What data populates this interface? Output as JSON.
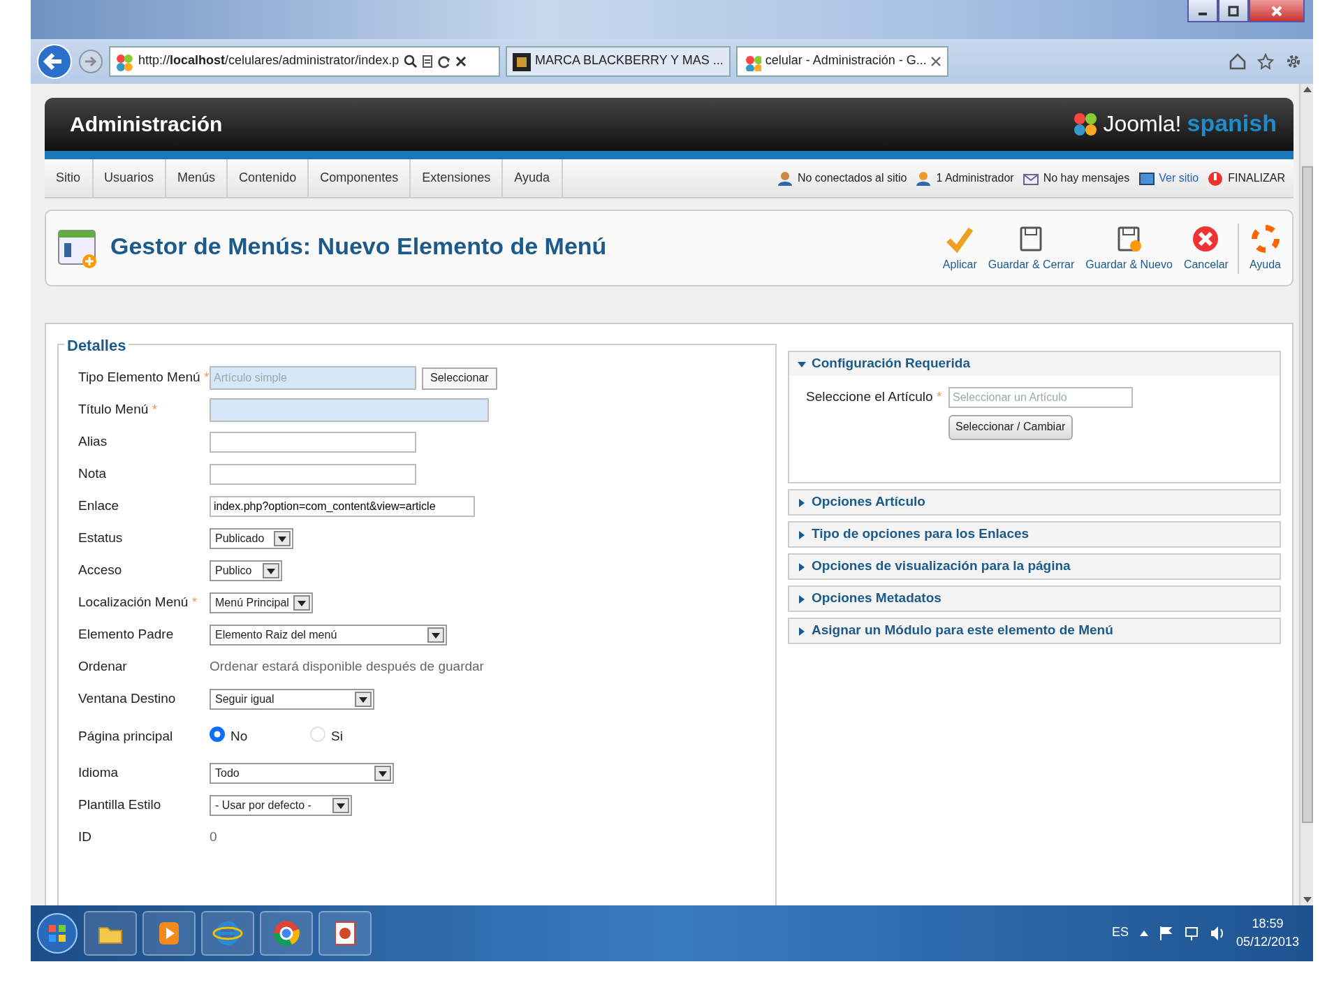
{
  "browser": {
    "address": "http://**localhost**/celulares/administrator/index.p",
    "tabs": [
      {
        "title": "MARCA BLACKBERRY Y MAS ...",
        "selected": false,
        "closable": false
      },
      {
        "title": "celular - Administración - G...",
        "selected": true,
        "closable": true
      }
    ]
  },
  "header": {
    "title": "Administración",
    "logo_text": "Joomla!",
    "logo_tag": "spanish"
  },
  "menu": [
    "Sitio",
    "Usuarios",
    "Menús",
    "Contenido",
    "Componentes",
    "Extensiones",
    "Ayuda"
  ],
  "status": [
    {
      "kind": "users",
      "text": "No conectados al sitio"
    },
    {
      "kind": "admin",
      "text": "1 Administrador"
    },
    {
      "kind": "messages",
      "text": "No hay mensajes"
    },
    {
      "kind": "site",
      "text": "Ver sitio"
    },
    {
      "kind": "logout",
      "text": "FINALIZAR"
    }
  ],
  "toolbar": {
    "title": "Gestor de Menús: Nuevo Elemento de Menú",
    "buttons": [
      {
        "kind": "apply",
        "label": "Aplicar"
      },
      {
        "kind": "save-close",
        "label": "Guardar & Cerrar"
      },
      {
        "kind": "save-new",
        "label": "Guardar & Nuevo"
      },
      {
        "kind": "cancel",
        "label": "Cancelar"
      },
      {
        "kind": "help",
        "label": "Ayuda"
      }
    ]
  },
  "details": {
    "legend": "Detalles",
    "required_mark": "*",
    "fields": [
      {
        "label": "Tipo Elemento Menú",
        "required": true,
        "kind": "input",
        "placeholder": "Artículo simple",
        "highlighted": true,
        "button": "Seleccionar"
      },
      {
        "label": "Título Menú",
        "required": true,
        "kind": "input",
        "highlighted": true
      },
      {
        "label": "Alias",
        "required": false,
        "kind": "input",
        "highlighted": false
      },
      {
        "label": "Nota",
        "required": false,
        "kind": "input",
        "highlighted": false
      },
      {
        "label": "Enlace",
        "required": false,
        "kind": "input",
        "value": "index.php?option=com_content&view=article",
        "highlighted": false
      },
      {
        "label": "Estatus",
        "required": false,
        "kind": "select",
        "value": "Publicado"
      },
      {
        "label": "Acceso",
        "required": false,
        "kind": "select",
        "value": "Publico"
      },
      {
        "label": "Localización Menú",
        "required": true,
        "kind": "select",
        "value": "Menú Principal"
      },
      {
        "label": "Elemento Padre",
        "required": false,
        "kind": "select",
        "value": "Elemento Raiz del menú"
      },
      {
        "label": "Ordenar",
        "required": false,
        "kind": "note",
        "value": "Ordenar estará disponible después de guardar"
      },
      {
        "label": "Ventana Destino",
        "required": false,
        "kind": "select",
        "value": "Seguir igual"
      },
      {
        "label": "Página principal",
        "required": false,
        "kind": "radio",
        "options": [
          {
            "label": "No",
            "selected": true
          },
          {
            "label": "Si",
            "selected": false
          }
        ]
      },
      {
        "label": "Idioma",
        "required": false,
        "kind": "select",
        "value": "Todo"
      },
      {
        "label": "Plantilla Estilo",
        "required": false,
        "kind": "select",
        "value": "- Usar por defecto -"
      },
      {
        "label": "ID",
        "required": false,
        "kind": "text",
        "value": "0"
      }
    ]
  },
  "panels": [
    {
      "title": "Configuración Requerida",
      "expanded": true,
      "field": {
        "label": "Seleccione el Artículo",
        "required": true,
        "required_mark": "*",
        "placeholder": "Seleccionar un Artículo",
        "button": "Seleccionar / Cambiar"
      }
    },
    {
      "title": "Opciones Artículo",
      "expanded": false
    },
    {
      "title": "Tipo de opciones para los Enlaces",
      "expanded": false
    },
    {
      "title": "Opciones de visualización para la página",
      "expanded": false
    },
    {
      "title": "Opciones Metadatos",
      "expanded": false
    },
    {
      "title": "Asignar un Módulo para este elemento de Menú",
      "expanded": false
    }
  ],
  "taskbar": {
    "language": "ES",
    "time": "18:59",
    "date": "05/12/2013"
  }
}
